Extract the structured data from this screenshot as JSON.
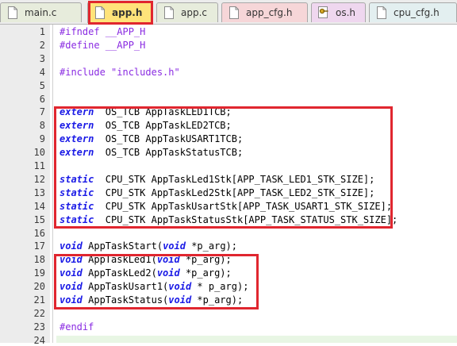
{
  "tabs": [
    {
      "name": "main.c",
      "type": "c"
    },
    {
      "name": "app.h",
      "type": "h",
      "active": true
    },
    {
      "name": "app.c",
      "type": "c"
    },
    {
      "name": "app_cfg.h",
      "type": "h"
    },
    {
      "name": "os.h",
      "type": "os"
    },
    {
      "name": "cpu_cfg.h",
      "type": "h"
    }
  ],
  "lines": [
    {
      "n": "1",
      "t": [
        [
          "pp",
          "#ifndef __APP_H"
        ]
      ]
    },
    {
      "n": "2",
      "t": [
        [
          "pp",
          "#define __APP_H"
        ]
      ]
    },
    {
      "n": "3",
      "t": []
    },
    {
      "n": "4",
      "t": [
        [
          "pp",
          "#include "
        ],
        [
          "str",
          "\"includes.h\""
        ]
      ]
    },
    {
      "n": "5",
      "t": []
    },
    {
      "n": "6",
      "t": []
    },
    {
      "n": "7",
      "t": [
        [
          "kw",
          "extern"
        ],
        [
          "",
          "  OS_TCB AppTaskLED1TCB;"
        ]
      ]
    },
    {
      "n": "8",
      "t": [
        [
          "kw",
          "extern"
        ],
        [
          "",
          "  OS_TCB AppTaskLED2TCB;"
        ]
      ]
    },
    {
      "n": "9",
      "t": [
        [
          "kw",
          "extern"
        ],
        [
          "",
          "  OS_TCB AppTaskUSART1TCB;"
        ]
      ]
    },
    {
      "n": "10",
      "t": [
        [
          "kw",
          "extern"
        ],
        [
          "",
          "  OS_TCB AppTaskStatusTCB;"
        ]
      ]
    },
    {
      "n": "11",
      "t": []
    },
    {
      "n": "12",
      "t": [
        [
          "kw",
          "static"
        ],
        [
          "",
          "  CPU_STK AppTaskLed1Stk[APP_TASK_LED1_STK_SIZE];"
        ]
      ]
    },
    {
      "n": "13",
      "t": [
        [
          "kw",
          "static"
        ],
        [
          "",
          "  CPU_STK AppTaskLed2Stk[APP_TASK_LED2_STK_SIZE];"
        ]
      ]
    },
    {
      "n": "14",
      "t": [
        [
          "kw",
          "static"
        ],
        [
          "",
          "  CPU_STK AppTaskUsartStk[APP_TASK_USART1_STK_SIZE];"
        ]
      ]
    },
    {
      "n": "15",
      "t": [
        [
          "kw",
          "static"
        ],
        [
          "",
          "  CPU_STK AppTaskStatusStk[APP_TASK_STATUS_STK_SIZE];"
        ]
      ]
    },
    {
      "n": "16",
      "t": []
    },
    {
      "n": "17",
      "t": [
        [
          "kw",
          "void"
        ],
        [
          "",
          " AppTaskStart("
        ],
        [
          "kw",
          "void"
        ],
        [
          "",
          " *p_arg);"
        ]
      ]
    },
    {
      "n": "18",
      "t": [
        [
          "kw",
          "void"
        ],
        [
          "",
          " AppTaskLed1("
        ],
        [
          "kw",
          "void"
        ],
        [
          "",
          " *p_arg);"
        ]
      ]
    },
    {
      "n": "19",
      "t": [
        [
          "kw",
          "void"
        ],
        [
          "",
          " AppTaskLed2("
        ],
        [
          "kw",
          "void"
        ],
        [
          "",
          " *p_arg);"
        ]
      ]
    },
    {
      "n": "20",
      "t": [
        [
          "kw",
          "void"
        ],
        [
          "",
          " AppTaskUsart1("
        ],
        [
          "kw",
          "void"
        ],
        [
          "",
          " * p_arg);"
        ]
      ]
    },
    {
      "n": "21",
      "t": [
        [
          "kw",
          "void"
        ],
        [
          "",
          " AppTaskStatus("
        ],
        [
          "kw",
          "void"
        ],
        [
          "",
          " *p_arg);"
        ]
      ]
    },
    {
      "n": "22",
      "t": []
    },
    {
      "n": "23",
      "t": [
        [
          "pp",
          "#endif"
        ]
      ]
    },
    {
      "n": "24",
      "t": []
    }
  ],
  "colors": {
    "highlight_box": "#e0262f",
    "keyword": "#1a1ae6",
    "preprocessor": "#8a2be2"
  }
}
